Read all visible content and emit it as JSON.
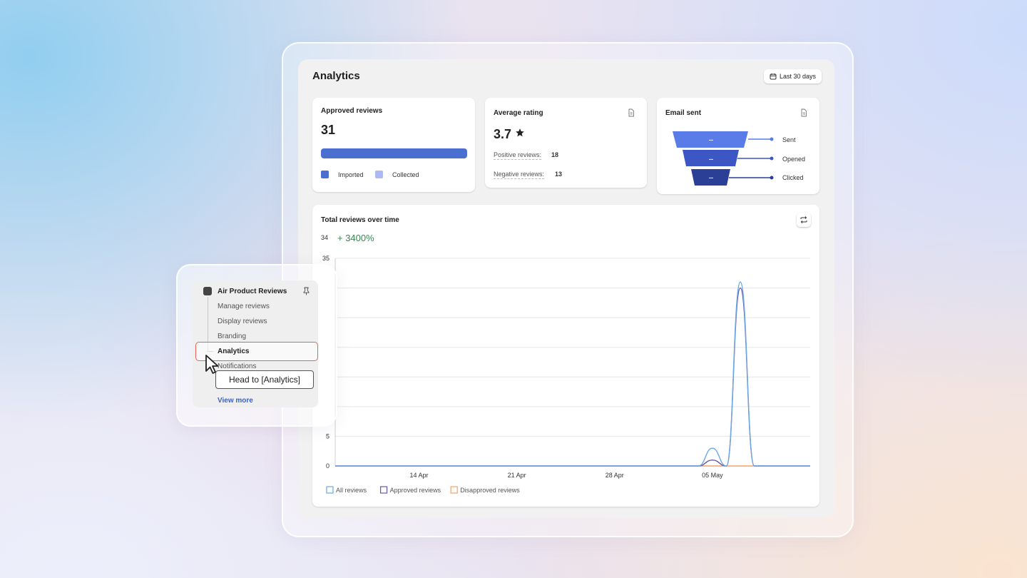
{
  "analytics": {
    "title": "Analytics",
    "date_range_label": "Last 30 days"
  },
  "approved_reviews": {
    "title": "Approved reviews",
    "value": "31",
    "legend": [
      {
        "label": "Imported",
        "color": "#4a6fd0"
      },
      {
        "label": "Collected",
        "color": "#aeb9f3"
      }
    ],
    "imported_fraction": 1.0
  },
  "average_rating": {
    "title": "Average rating",
    "value": "3.7",
    "positive_label": "Positive reviews:",
    "positive_value": "18",
    "negative_label": "Negative reviews:",
    "negative_value": "13"
  },
  "email_sent": {
    "title": "Email sent",
    "stages": [
      {
        "label": "Sent",
        "value": "--",
        "color": "#5a7ce8"
      },
      {
        "label": "Opened",
        "value": "--",
        "color": "#3c56c4"
      },
      {
        "label": "Clicked",
        "value": "--",
        "color": "#2b3f97"
      }
    ]
  },
  "chart_card": {
    "title": "Total reviews over time",
    "total": "34",
    "change": "+ 3400%"
  },
  "chart_data": {
    "type": "line",
    "title": "Total reviews over time",
    "xlabel": "",
    "ylabel": "",
    "ylim": [
      0,
      35
    ],
    "yticks": [
      0,
      5,
      35
    ],
    "xticks": [
      "14 Apr",
      "21 Apr",
      "28 Apr",
      "05 May"
    ],
    "x": [
      "08 Apr",
      "09 Apr",
      "10 Apr",
      "11 Apr",
      "12 Apr",
      "13 Apr",
      "14 Apr",
      "15 Apr",
      "16 Apr",
      "17 Apr",
      "18 Apr",
      "19 Apr",
      "20 Apr",
      "21 Apr",
      "22 Apr",
      "23 Apr",
      "24 Apr",
      "25 Apr",
      "26 Apr",
      "27 Apr",
      "28 Apr",
      "29 Apr",
      "30 Apr",
      "01 May",
      "02 May",
      "03 May",
      "04 May",
      "05 May",
      "06 May",
      "07 May",
      "08 May",
      "09 May",
      "10 May",
      "11 May",
      "12 May"
    ],
    "grid": true,
    "legend_position": "bottom-left",
    "series": [
      {
        "name": "All reviews",
        "color": "#6aa8e6",
        "values": [
          0,
          0,
          0,
          0,
          0,
          0,
          0,
          0,
          0,
          0,
          0,
          0,
          0,
          0,
          0,
          0,
          0,
          0,
          0,
          0,
          0,
          0,
          0,
          0,
          0,
          0,
          0,
          3,
          0,
          31,
          0,
          0,
          0,
          0,
          0
        ]
      },
      {
        "name": "Approved reviews",
        "color": "#6a55a8",
        "values": [
          0,
          0,
          0,
          0,
          0,
          0,
          0,
          0,
          0,
          0,
          0,
          0,
          0,
          0,
          0,
          0,
          0,
          0,
          0,
          0,
          0,
          0,
          0,
          0,
          0,
          0,
          0,
          1,
          0,
          30,
          0,
          0,
          0,
          0,
          0
        ]
      },
      {
        "name": "Disapproved reviews",
        "color": "#f0a46a",
        "values": [
          0,
          0,
          0,
          0,
          0,
          0,
          0,
          0,
          0,
          0,
          0,
          0,
          0,
          0,
          0,
          0,
          0,
          0,
          0,
          0,
          0,
          0,
          0,
          0,
          0,
          0,
          0,
          0,
          0,
          0,
          0,
          0,
          0,
          0,
          0
        ]
      }
    ]
  },
  "sidebar": {
    "app_name": "Air Product Reviews",
    "items": [
      {
        "label": "Manage reviews"
      },
      {
        "label": "Display reviews"
      },
      {
        "label": "Branding"
      },
      {
        "label": "Analytics"
      },
      {
        "label": "Notifications"
      }
    ],
    "view_more": "View more",
    "tooltip": "Head to [Analytics]"
  }
}
